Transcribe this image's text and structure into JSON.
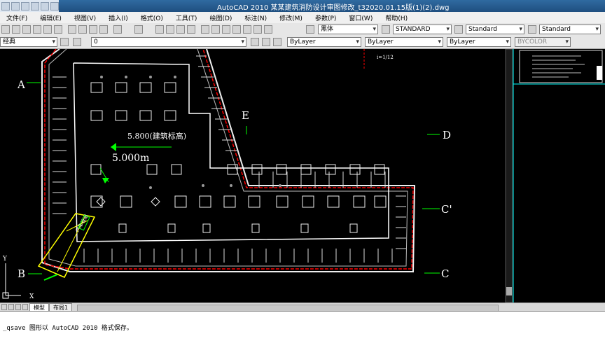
{
  "title": "AutoCAD 2010  某某建筑消防设计审图修改_t32020.01.15版(1)(2).dwg",
  "menu": [
    "文件(F)",
    "编辑(E)",
    "视图(V)",
    "插入(I)",
    "格式(O)",
    "工具(T)",
    "绘图(D)",
    "标注(N)",
    "修改(M)",
    "参数(P)",
    "窗口(W)",
    "帮助(H)"
  ],
  "toolbar": {
    "text_style": "黑体",
    "dim_style": "STANDARD",
    "table_style": "Standard",
    "multileader_style": "Standard",
    "workspace": "经典",
    "layer": "0",
    "color": "ByLayer",
    "linetype": "ByLayer",
    "lineweight": "ByLayer",
    "plotstyle": "BYCOLOR"
  },
  "drawing": {
    "grid_labels": {
      "A": "A",
      "B": "B",
      "C": "C",
      "C2": "C'",
      "D": "D",
      "E": "E"
    },
    "elevation_text": "5.800(建筑标高)",
    "slope_text": "5.000m",
    "entry_note": "汽车坡道",
    "ucs": {
      "y": "Y",
      "x": "X"
    }
  },
  "tabs": [
    "模型",
    "布局1"
  ],
  "command_line": "_qsave 图形以 AutoCAD 2010 格式保存。"
}
